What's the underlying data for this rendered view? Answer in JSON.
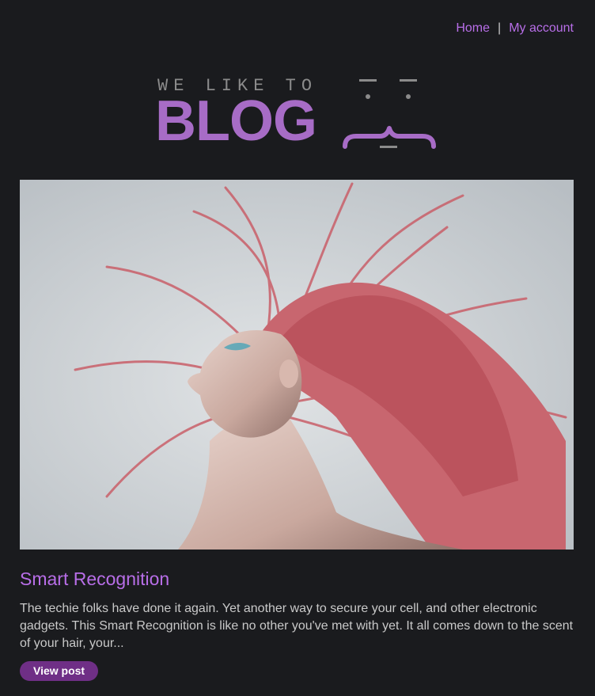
{
  "nav": {
    "home_label": "Home",
    "separator": "|",
    "account_label": "My account"
  },
  "logo": {
    "tagline": "WE LIKE TO",
    "wordmark": "BLOG",
    "tagline_color": "#8b8b8b",
    "wordmark_color": "#a76cc6"
  },
  "hero": {
    "icon": "hero-image"
  },
  "post": {
    "title": "Smart Recognition",
    "excerpt": "The techie folks have done it again. Yet another way to secure your cell, and other electronic gadgets. This Smart Recognition is like no other you've met with yet. It all comes down to the scent of your hair, your...",
    "button_label": "View post"
  },
  "colors": {
    "background": "#1a1b1e",
    "link": "#b86ee8",
    "text": "#c9c9c9",
    "button": "#6f2f86"
  }
}
